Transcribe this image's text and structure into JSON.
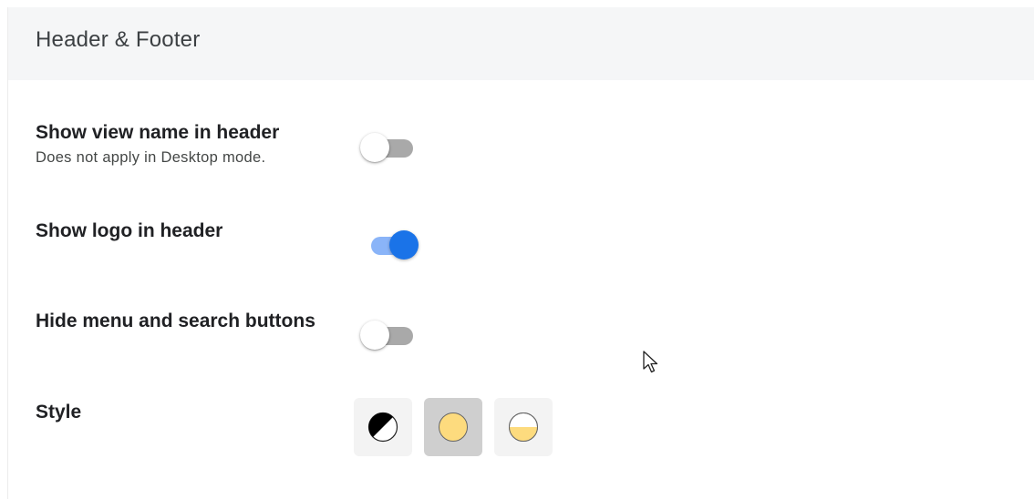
{
  "section": {
    "title": "Header & Footer"
  },
  "settings": {
    "view_name": {
      "label": "Show view name in header",
      "description": "Does not apply in Desktop mode.",
      "enabled": false
    },
    "logo": {
      "label": "Show logo in header",
      "enabled": true
    },
    "hide_buttons": {
      "label": "Hide menu and search buttons",
      "enabled": false
    },
    "style": {
      "label": "Style",
      "options": [
        {
          "icon": "contrast-icon",
          "selected": false
        },
        {
          "icon": "filled-circle-icon",
          "selected": true
        },
        {
          "icon": "half-filled-circle-icon",
          "selected": false
        }
      ]
    }
  },
  "colors": {
    "toggle_on_thumb": "#1a73e8",
    "toggle_on_track": "#8ab4f8",
    "toggle_off_track": "#a9a9a9",
    "style_fill": "#fddb7e"
  }
}
